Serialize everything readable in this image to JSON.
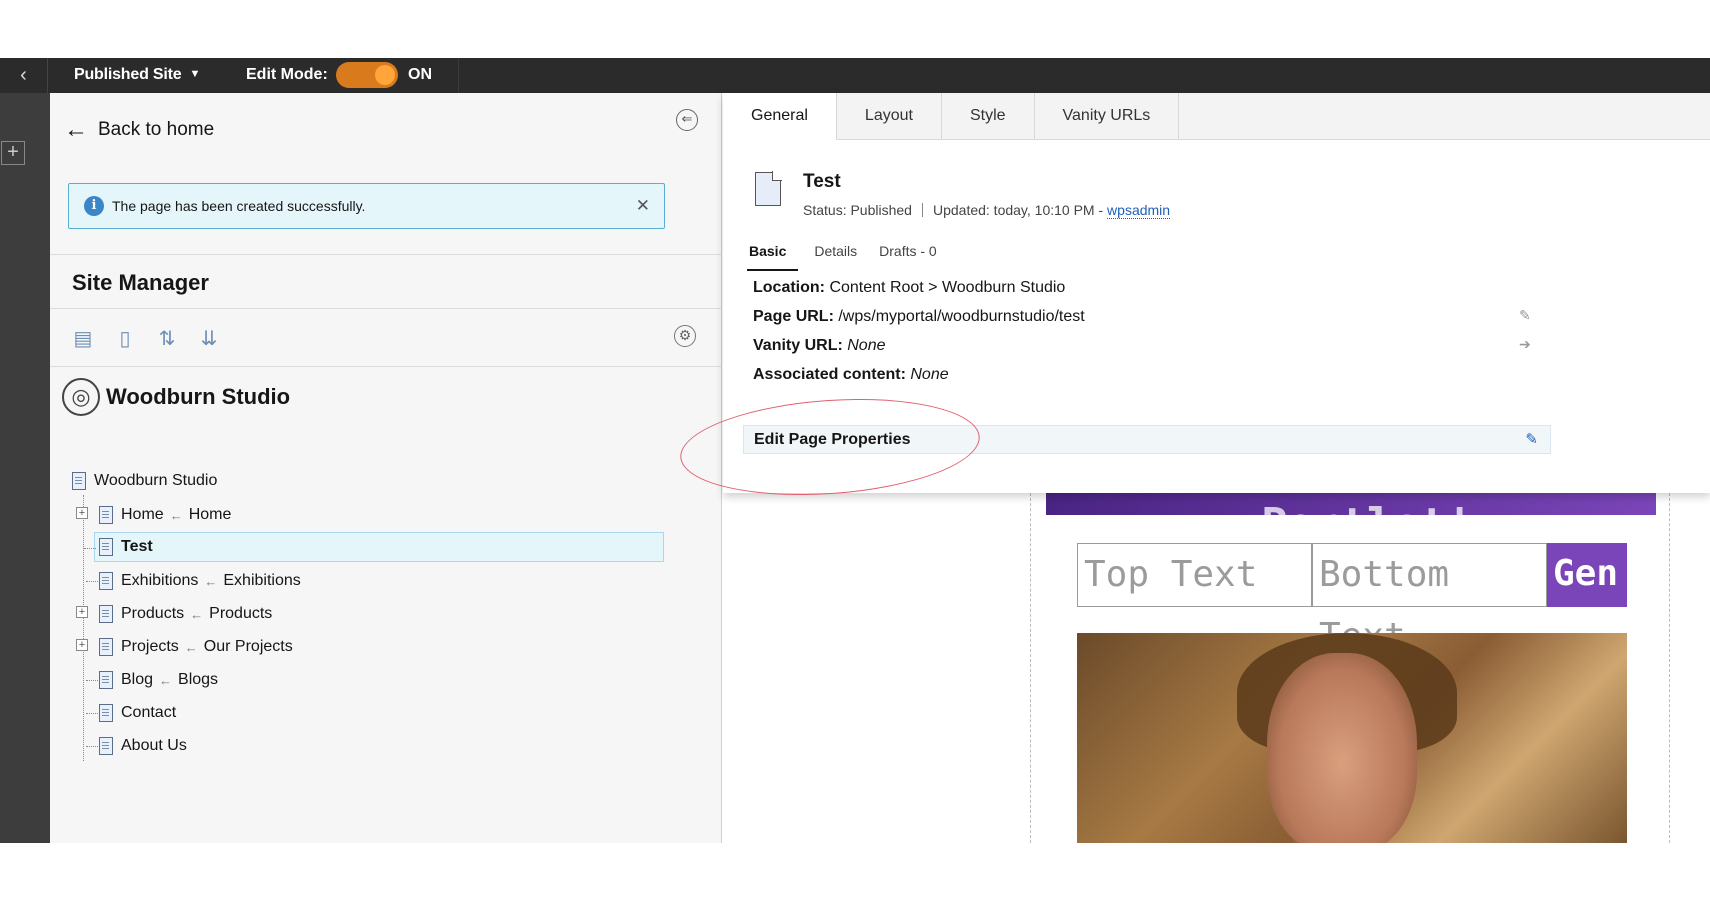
{
  "topbar": {
    "back_glyph": "‹",
    "site_label": "Published Site",
    "edit_mode_label": "Edit Mode:",
    "edit_mode_state": "ON"
  },
  "rail": {
    "add_glyph": "+"
  },
  "panel": {
    "back_label": "Back to home",
    "notification": "The page has been created successfully.",
    "title": "Site Manager",
    "site_name": "Woodburn Studio",
    "tree": [
      {
        "label": "Woodburn Studio",
        "source": ""
      },
      {
        "label": "Home",
        "source": "Home"
      },
      {
        "label": "Test",
        "source": ""
      },
      {
        "label": "Exhibitions",
        "source": "Exhibitions"
      },
      {
        "label": "Products",
        "source": "Products"
      },
      {
        "label": "Projects",
        "source": "Our Projects"
      },
      {
        "label": "Blog",
        "source": "Blogs"
      },
      {
        "label": "Contact",
        "source": ""
      },
      {
        "label": "About Us",
        "source": ""
      }
    ]
  },
  "props": {
    "tabs": [
      "General",
      "Layout",
      "Style",
      "Vanity URLs"
    ],
    "page_title": "Test",
    "status": "Status: Published",
    "updated": "Updated: today, 10:10 PM -",
    "user": "wpsadmin",
    "subtabs": [
      "Basic",
      "Details",
      "Drafts - 0"
    ],
    "location_label": "Location:",
    "location_value": "Content Root  >  Woodburn Studio",
    "url_label": "Page URL:",
    "url_value": "/wps/myportal/woodburnstudio/test",
    "vanity_label": "Vanity URL:",
    "vanity_value": "None",
    "assoc_label": "Associated content:",
    "assoc_value": "None",
    "edit_label": "Edit Page Properties"
  },
  "preview": {
    "banner_text": "Portlet!",
    "top_text": "Top Text",
    "bottom_text": "Bottom Text",
    "gen_label": "Gen"
  },
  "colors": {
    "topbar": "#2b2b2b",
    "toggle": "#d97b1c",
    "accent_link": "#1f5fb8",
    "notice_bg": "#e5f6fb",
    "banner": "#7a45b8",
    "annotation": "#e06070"
  }
}
